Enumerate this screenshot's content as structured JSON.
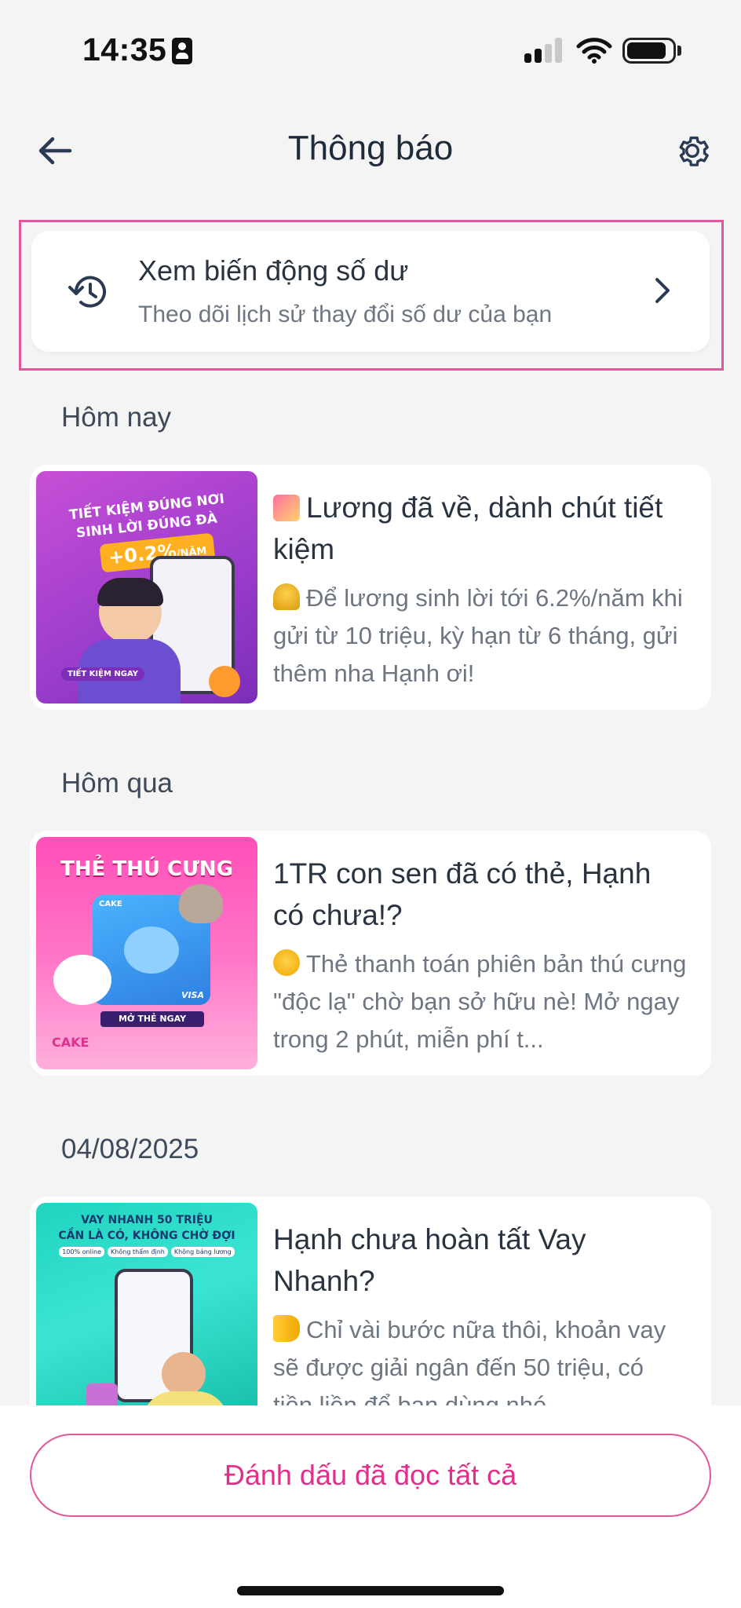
{
  "status_bar": {
    "time": "14:35"
  },
  "header": {
    "title": "Thông báo"
  },
  "balance_card": {
    "title": "Xem biến động số dư",
    "subtitle": "Theo dõi lịch sử thay đổi số dư của bạn"
  },
  "sections": [
    {
      "label": "Hôm nay",
      "notification": {
        "title": "Lương đã về, dành chút tiết kiệm",
        "body": "Để lương sinh lời tới 6.2%/năm khi gửi từ 10 triệu, kỳ hạn từ 6 tháng, gửi thêm nha Hạnh ơi!",
        "thumb": {
          "headline_1": "TIẾT KIỆM ĐÚNG NƠI",
          "headline_2": "SINH LỜI ĐÚNG ĐÀ",
          "rate": "+0.2%",
          "rate_unit": "/NĂM",
          "cta": "TIẾT KIỆM NGAY"
        }
      }
    },
    {
      "label": "Hôm qua",
      "notification": {
        "title": "1TR con sen đã có thẻ, Hạnh có chưa!?",
        "body": "Thẻ thanh toán phiên bản thú cưng \"độc lạ\" chờ bạn sở hữu nè! Mở ngay trong 2 phút, miễn phí t...",
        "thumb": {
          "headline": "THẺ THÚ CƯNG",
          "brand": "CAKE",
          "cta": "MỞ THẺ NGAY",
          "network": "VISA"
        }
      }
    },
    {
      "label": "04/08/2025",
      "notification": {
        "title": "Hạnh  chưa hoàn tất Vay Nhanh?",
        "body": "Chỉ vài bước nữa thôi, khoản vay sẽ được giải ngân đến 50 triệu, có tiền liền để bạn dùng nhé",
        "thumb": {
          "headline_1": "VAY NHANH 50 TRIỆU",
          "headline_2": "CẦN LÀ CÓ, KHÔNG CHỜ ĐỢI",
          "tags": [
            "100% online",
            "Không thẩm định",
            "Không bảng lương"
          ]
        }
      }
    }
  ],
  "footer": {
    "mark_all_label": "Đánh dấu đã đọc tất cả"
  },
  "colors": {
    "accent": "#e0308a",
    "frame": "#e0589a",
    "background": "#f4f4f5"
  }
}
